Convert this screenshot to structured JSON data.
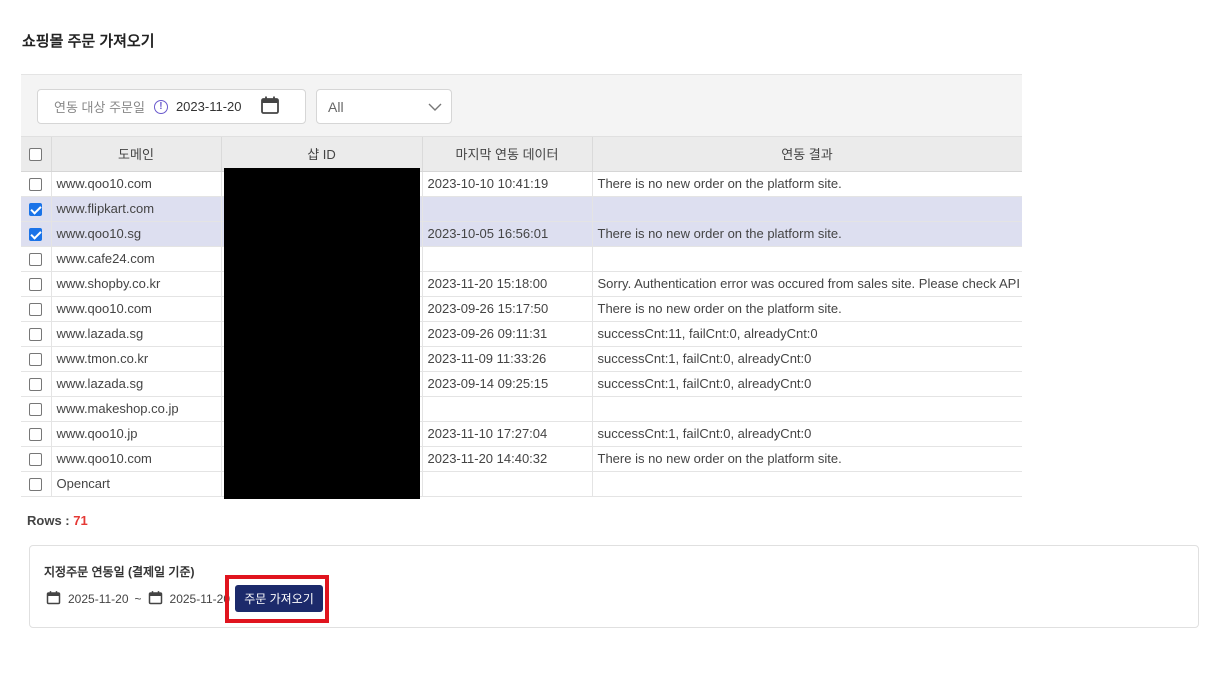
{
  "page": {
    "title": "쇼핑몰 주문 가져오기"
  },
  "toolbar": {
    "date_label": "연동 대상 주문일",
    "date_value": "2023-11-20",
    "select_value": "All"
  },
  "table": {
    "columns": [
      "도메인",
      "샵 ID",
      "마지막 연동 데이터",
      "연동 결과"
    ],
    "rows": [
      {
        "checked": false,
        "domain": "www.qoo10.com",
        "last_sync": "2023-10-10 10:41:19",
        "result": "There is no new order on the platform site.",
        "status": "ok"
      },
      {
        "checked": true,
        "domain": "www.flipkart.com",
        "last_sync": "",
        "result": "",
        "status": "ok"
      },
      {
        "checked": true,
        "domain": "www.qoo10.sg",
        "last_sync": "2023-10-05 16:56:01",
        "result": "There is no new order on the platform site.",
        "status": "ok"
      },
      {
        "checked": false,
        "domain": "www.cafe24.com",
        "last_sync": "",
        "result": "",
        "status": "ok"
      },
      {
        "checked": false,
        "domain": "www.shopby.co.kr",
        "last_sync": "2023-11-20 15:18:00",
        "result": "Sorry. Authentication error was occured from sales site. Please check API",
        "status": "err"
      },
      {
        "checked": false,
        "domain": "www.qoo10.com",
        "last_sync": "2023-09-26 15:17:50",
        "result": "There is no new order on the platform site.",
        "status": "ok"
      },
      {
        "checked": false,
        "domain": "www.lazada.sg",
        "last_sync": "2023-09-26 09:11:31",
        "result": "successCnt:11, failCnt:0, alreadyCnt:0",
        "status": "ok"
      },
      {
        "checked": false,
        "domain": "www.tmon.co.kr",
        "last_sync": "2023-11-09 11:33:26",
        "result": "successCnt:1, failCnt:0, alreadyCnt:0",
        "status": "ok"
      },
      {
        "checked": false,
        "domain": "www.lazada.sg",
        "last_sync": "2023-09-14 09:25:15",
        "result": "successCnt:1, failCnt:0, alreadyCnt:0",
        "status": "ok"
      },
      {
        "checked": false,
        "domain": "www.makeshop.co.jp",
        "last_sync": "",
        "result": "",
        "status": "ok"
      },
      {
        "checked": false,
        "domain": "www.qoo10.jp",
        "last_sync": "2023-11-10 17:27:04",
        "result": "successCnt:1, failCnt:0, alreadyCnt:0",
        "status": "ok"
      },
      {
        "checked": false,
        "domain": "www.qoo10.com",
        "last_sync": "2023-11-20 14:40:32",
        "result": "There is no new order on the platform site.",
        "status": "ok"
      },
      {
        "checked": false,
        "domain": "Opencart",
        "last_sync": "",
        "result": "",
        "status": "ok"
      }
    ],
    "rows_label": "Rows : ",
    "rows_count": "71"
  },
  "range": {
    "title": "지정주문 연동일 (결제일 기준)",
    "start": "2025-11-20",
    "separator": "~",
    "end": "2025-11-20",
    "button_label": "주문 가져오기"
  },
  "colors": {
    "ok": "#1e8e1e",
    "err": "#e53935",
    "button": "#1c2a6b",
    "highlight": "#e0141e"
  }
}
